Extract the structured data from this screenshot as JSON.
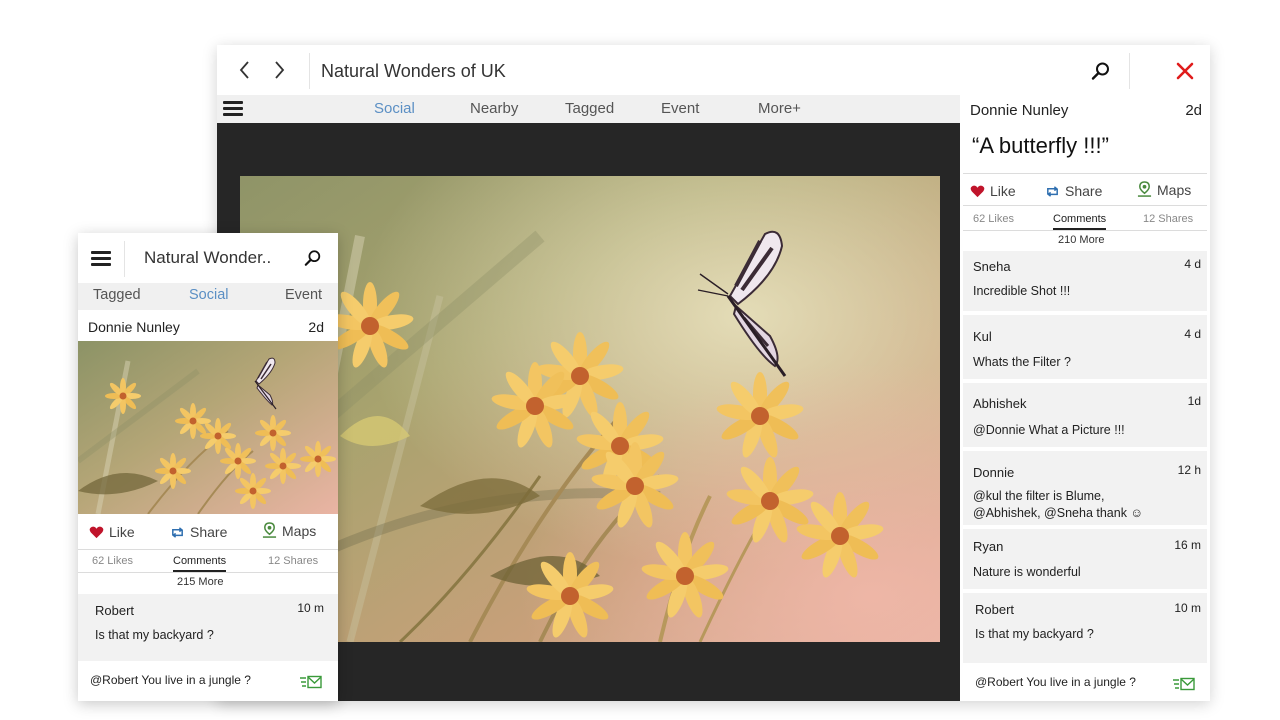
{
  "desktop": {
    "title": "Natural Wonders of UK",
    "tabs": [
      {
        "label": "Social",
        "active": true
      },
      {
        "label": "Nearby",
        "active": false
      },
      {
        "label": "Tagged",
        "active": false
      },
      {
        "label": "Event",
        "active": false
      },
      {
        "label": "More+",
        "active": false
      }
    ],
    "post": {
      "author": "Donnie Nunley",
      "age": "2d",
      "caption": "“A butterfly !!!”",
      "actions": {
        "like": "Like",
        "share": "Share",
        "maps": "Maps"
      },
      "stats": {
        "likes": "62 Likes",
        "comments": "Comments",
        "shares": "12 Shares"
      },
      "more": "210 More"
    },
    "comments": [
      {
        "name": "Sneha",
        "age": "4 d",
        "text": "Incredible Shot !!!"
      },
      {
        "name": "Kul",
        "age": "4 d",
        "text": "Whats the Filter ?"
      },
      {
        "name": "Abhishek",
        "age": "1d",
        "text": "@Donnie What a Picture !!!"
      },
      {
        "name": "Donnie",
        "age": "12 h",
        "text_line1": "@kul the filter is Blume,",
        "text_line2": "@Abhishek, @Sneha thank ☺"
      },
      {
        "name": "Ryan",
        "age": "16 m",
        "text": "Nature is wonderful"
      },
      {
        "name": "Robert",
        "age": "10 m",
        "text": "Is that my backyard ?"
      }
    ],
    "reply": "@Robert You live in a jungle ?"
  },
  "phone": {
    "title": "Natural Wonder..",
    "tabs": [
      {
        "label": "Tagged",
        "active": false
      },
      {
        "label": "Social",
        "active": true
      },
      {
        "label": "Event",
        "active": false
      }
    ],
    "post": {
      "author": "Donnie Nunley",
      "age": "2d",
      "actions": {
        "like": "Like",
        "share": "Share",
        "maps": "Maps"
      },
      "stats": {
        "likes": "62 Likes",
        "comments": "Comments",
        "shares": "12 Shares"
      },
      "more": "215 More"
    },
    "comment": {
      "name": "Robert",
      "age": "10 m",
      "text": "Is that my backyard ?"
    },
    "reply": "@Robert You live in a jungle ?"
  },
  "icons": {
    "back": "chevron-left-icon",
    "forward": "chevron-right-icon",
    "search": "search-icon",
    "close": "close-icon",
    "menu": "hamburger-menu-icon",
    "like": "heart-icon",
    "share": "retweet-icon",
    "maps": "map-pin-icon",
    "send": "send-message-icon"
  },
  "colors": {
    "accent_tab": "#5b8fc4",
    "close": "#e01b1b",
    "like": "#c0142b",
    "share": "#2f6fb0",
    "maps": "#4a8a3e",
    "send": "#3a9a3a",
    "viewer_bg": "#262626",
    "comment_bg": "#f2f2f2"
  }
}
